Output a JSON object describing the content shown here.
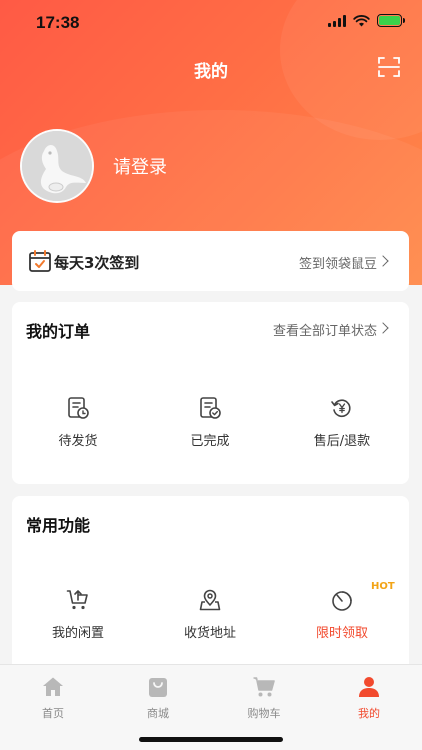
{
  "status_bar": {
    "time": "17:38"
  },
  "header": {
    "title": "我的",
    "login_text": "请登录"
  },
  "signin": {
    "title": "每天3次签到",
    "link": "签到领袋鼠豆"
  },
  "orders": {
    "title": "我的订单",
    "view_all": "查看全部订单状态",
    "items": [
      {
        "label": "待发货",
        "icon": "pending-shipment-icon"
      },
      {
        "label": "已完成",
        "icon": "completed-order-icon"
      },
      {
        "label": "售后/退款",
        "icon": "refund-icon"
      }
    ]
  },
  "functions": {
    "title": "常用功能",
    "items": [
      {
        "label": "我的闲置",
        "icon": "idle-cart-icon"
      },
      {
        "label": "收货地址",
        "icon": "address-icon"
      },
      {
        "label": "限时领取",
        "icon": "timer-icon",
        "badge": "HOT"
      }
    ]
  },
  "tabbar": {
    "items": [
      {
        "label": "首页",
        "icon": "home-icon",
        "active": false
      },
      {
        "label": "商城",
        "icon": "mall-bag-icon",
        "active": false
      },
      {
        "label": "购物车",
        "icon": "cart-icon",
        "active": false
      },
      {
        "label": "我的",
        "icon": "profile-icon",
        "active": true
      }
    ]
  },
  "colors": {
    "header_gradient_start": "#ff5a45",
    "header_gradient_end": "#ff8a4a",
    "accent": "#f24a2e",
    "hot_badge": "#f2a417",
    "background": "#f4f4f4"
  }
}
